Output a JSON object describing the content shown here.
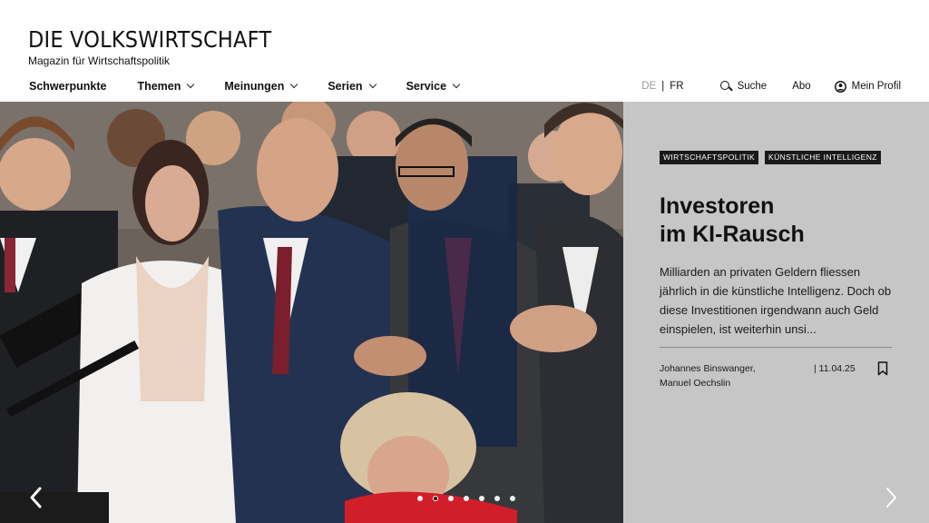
{
  "brand": {
    "title": "DIE VOLKSWIRTSCHAFT",
    "subtitle": "Magazin für Wirtschaftspolitik"
  },
  "nav": {
    "items": [
      {
        "label": "Schwerpunkte",
        "has_dropdown": false
      },
      {
        "label": "Themen",
        "has_dropdown": true
      },
      {
        "label": "Meinungen",
        "has_dropdown": true
      },
      {
        "label": "Serien",
        "has_dropdown": true
      },
      {
        "label": "Service",
        "has_dropdown": true
      }
    ]
  },
  "tools": {
    "lang_de": "DE",
    "lang_separator": "|",
    "lang_fr": "FR",
    "active_language": "DE",
    "search_label": "Suche",
    "abo_label": "Abo",
    "profile_label": "Mein Profil"
  },
  "hero": {
    "tags": [
      "WIRTSCHAFTSPOLITIK",
      "KÜNSTLICHE INTELLIGENZ"
    ],
    "headline_line1": "Investoren",
    "headline_line2": "im KI-Rausch",
    "lead": "Milliarden an privaten Geldern fliessen jährlich in die künstliche Intelligenz. Doch ob diese Investitionen irgendwann auch Geld einspielen, ist weiterhin unsi...",
    "author_line1": "Johannes Binswanger,",
    "author_line2": "Manuel Oechslin",
    "date": "| 11.04.25",
    "panel_color": "#c6c6c6"
  },
  "carousel": {
    "slide_count": 7,
    "active_index": 1
  },
  "icons": {
    "search": "search-icon",
    "profile": "user-circle-icon",
    "bookmark": "bookmark-icon",
    "prev": "chevron-left-icon",
    "next": "chevron-right-icon",
    "dropdown": "chevron-down-icon"
  }
}
